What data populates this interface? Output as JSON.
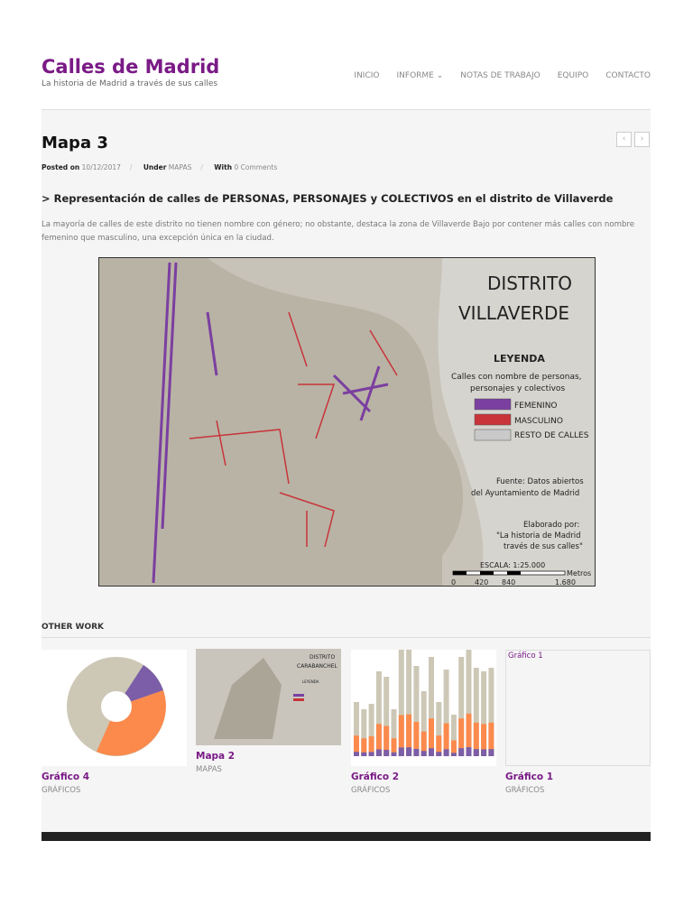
{
  "site": {
    "title": "Calles de Madrid",
    "tagline": "La historia de Madrid a través de sus calles"
  },
  "nav": [
    {
      "label": "INICIO"
    },
    {
      "label": "INFORME ⌄"
    },
    {
      "label": "NOTAS DE TRABAJO"
    },
    {
      "label": "EQUIPO"
    },
    {
      "label": "CONTACTO"
    }
  ],
  "post": {
    "title": "Mapa 3",
    "posted_label": "Posted on",
    "date": "10/12/2017",
    "under_label": "Under",
    "category": "MAPAS",
    "with_label": "With",
    "comments": "0 Comments",
    "subheading": "> Representación de calles de PERSONAS, PERSONAJES y COLECTIVOS en el distrito de Villaverde",
    "intro": "La mayoría de calles de este distrito no tienen nombre con género; no obstante, destaca la zona de Villaverde Bajo por contener más calles con nombre femenino que masculino, una excepción única en la ciudad."
  },
  "map": {
    "title1": "DISTRITO",
    "title2": "VILLAVERDE",
    "legend_title": "LEYENDA",
    "legend_sub1": "Calles con nombre de personas,",
    "legend_sub2": "personajes y colectivos",
    "legend": [
      {
        "label": "FEMENINO",
        "color": "#7b3fa0"
      },
      {
        "label": "MASCULINO",
        "color": "#c8343a"
      },
      {
        "label": "RESTO DE CALLES",
        "color": "#c9c9c9"
      }
    ],
    "source1": "Fuente: Datos abiertos",
    "source2": "del Ayuntamiento de Madrid",
    "made1": "Elaborado por:",
    "made2": "\"La historia de Madrid",
    "made3": "través de sus calles\"",
    "scale": "ESCALA: 1:25.000",
    "scale_unit": "Metros",
    "scale_ticks": [
      "0",
      "420",
      "840",
      "1.680"
    ]
  },
  "other_work": {
    "heading": "OTHER WORK",
    "items": [
      {
        "title": "Gráfico 4",
        "category": "GRÁFICOS"
      },
      {
        "title": "Mapa 2",
        "category": "MAPAS",
        "thumb1": "DISTRITO",
        "thumb2": "CARABANCHEL",
        "thumb3": "LEYENDA"
      },
      {
        "title": "Gráfico 2",
        "category": "GRÁFICOS"
      },
      {
        "title": "Gráfico 1",
        "category": "GRÁFICOS",
        "thumb_alt": "Gráfico 1"
      }
    ]
  },
  "nav_arrows": {
    "prev": "‹",
    "next": "›"
  }
}
